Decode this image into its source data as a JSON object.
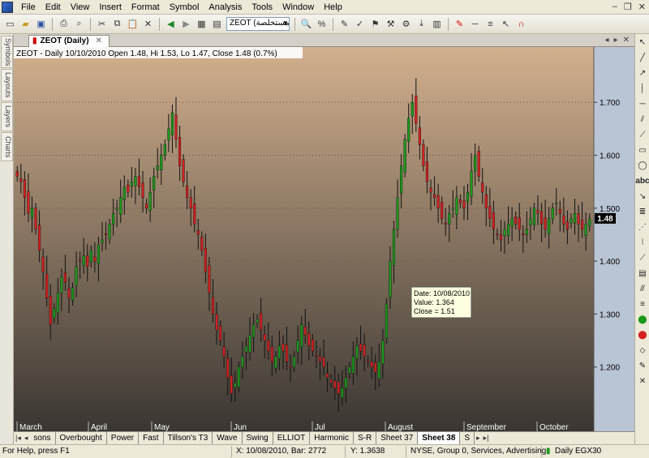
{
  "menu": [
    "File",
    "Edit",
    "View",
    "Insert",
    "Format",
    "Symbol",
    "Analysis",
    "Tools",
    "Window",
    "Help"
  ],
  "toolbar": {
    "symbol_combo": "ZEOT (مستخلصة"
  },
  "left_dock": [
    "Symbols",
    "Layouts",
    "Layers",
    "Charts"
  ],
  "document": {
    "tab": "ZEOT (Daily)",
    "info": "ZEOT - Daily 10/10/2010 Open 1.48, Hi 1.53, Lo 1.47, Close 1.48 (0.7%)"
  },
  "tooltip": {
    "date": "Date: 10/08/2010",
    "value": "Value: 1.364",
    "close": "Close = 1.51"
  },
  "colors": {
    "up": "#1a9a1a",
    "down": "#d42020",
    "panel_top": "#d2b08e",
    "panel_bottom": "#3a3632",
    "axis_bg": "#b9c4d4"
  },
  "chart_data": {
    "type": "candlestick",
    "symbol": "ZEOT",
    "interval": "Daily",
    "ylim": [
      1.1,
      1.78
    ],
    "y_ticks": [
      "1.700",
      "1.600",
      "1.500",
      "1.400",
      "1.300",
      "1.200"
    ],
    "x_ticks": [
      "March",
      "April",
      "May",
      "Jun",
      "Jul",
      "August",
      "September",
      "October"
    ],
    "last_value_label": "1.48",
    "closes": [
      1.56,
      1.55,
      1.52,
      1.49,
      1.5,
      1.46,
      1.42,
      1.38,
      1.33,
      1.28,
      1.31,
      1.34,
      1.37,
      1.36,
      1.33,
      1.35,
      1.39,
      1.4,
      1.41,
      1.39,
      1.42,
      1.4,
      1.43,
      1.44,
      1.45,
      1.47,
      1.49,
      1.5,
      1.52,
      1.54,
      1.53,
      1.55,
      1.56,
      1.54,
      1.52,
      1.5,
      1.53,
      1.56,
      1.58,
      1.6,
      1.62,
      1.65,
      1.68,
      1.63,
      1.58,
      1.55,
      1.52,
      1.5,
      1.47,
      1.45,
      1.42,
      1.38,
      1.34,
      1.3,
      1.27,
      1.25,
      1.22,
      1.18,
      1.15,
      1.17,
      1.2,
      1.22,
      1.24,
      1.26,
      1.28,
      1.29,
      1.27,
      1.25,
      1.23,
      1.21,
      1.22,
      1.24,
      1.23,
      1.21,
      1.2,
      1.22,
      1.25,
      1.28,
      1.26,
      1.24,
      1.23,
      1.22,
      1.21,
      1.2,
      1.18,
      1.17,
      1.16,
      1.15,
      1.16,
      1.18,
      1.2,
      1.22,
      1.24,
      1.23,
      1.22,
      1.21,
      1.2,
      1.19,
      1.21,
      1.25,
      1.32,
      1.4,
      1.46,
      1.52,
      1.58,
      1.63,
      1.67,
      1.7,
      1.66,
      1.62,
      1.58,
      1.55,
      1.53,
      1.52,
      1.5,
      1.48,
      1.47,
      1.49,
      1.5,
      1.52,
      1.51,
      1.5,
      1.53,
      1.57,
      1.6,
      1.56,
      1.53,
      1.5,
      1.48,
      1.46,
      1.45,
      1.44,
      1.46,
      1.47,
      1.48,
      1.47,
      1.46,
      1.45,
      1.46,
      1.48,
      1.5,
      1.49,
      1.47,
      1.46,
      1.48,
      1.5,
      1.51,
      1.49,
      1.47,
      1.46,
      1.48,
      1.49,
      1.47,
      1.46,
      1.47,
      1.48
    ]
  },
  "sheets": [
    "sons",
    "Overbought",
    "Power",
    "Fast",
    "Tillson's T3",
    "Wave",
    "Swing",
    "ELLIOT",
    "Harmonic",
    "S-R",
    "Sheet 37",
    "Sheet 38",
    "S"
  ],
  "active_sheet": "Sheet 38",
  "status": {
    "help": "For Help, press F1",
    "xinfo": "X: 10/08/2010, Bar: 2772",
    "yinfo": "Y: 1.3638",
    "exchange": "NYSE, Group 0, Services, Advertising",
    "feed": "Daily EGX30"
  }
}
